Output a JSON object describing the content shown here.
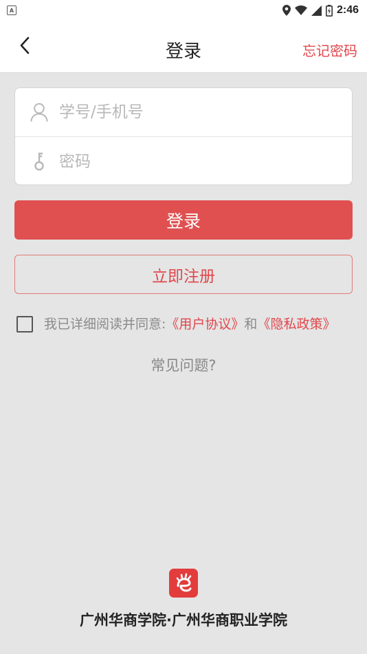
{
  "status_bar": {
    "time": "2:46",
    "notification_letter": "A",
    "icons": [
      "location-icon",
      "wifi-icon",
      "signal-icon",
      "battery-icon"
    ]
  },
  "header": {
    "title": "登录",
    "forgot_password": "忘记密码",
    "back_icon": "chevron-left-icon"
  },
  "form": {
    "username_placeholder": "学号/手机号",
    "username_value": "",
    "password_placeholder": "密码",
    "password_value": "",
    "username_icon": "user-icon",
    "password_icon": "key-icon"
  },
  "buttons": {
    "login": "登录",
    "register": "立即注册"
  },
  "agreement": {
    "checked": false,
    "prefix": "我已详细阅读并同意:",
    "user_agreement": "《用户协议》",
    "conjunction": "和",
    "privacy_policy": "《隐私政策》"
  },
  "faq": "常见问题?",
  "footer": {
    "text": "广州华商学院·广州华商职业学院",
    "logo_icon": "school-logo-icon"
  },
  "colors": {
    "accent": "#e05050",
    "link": "#e0474c",
    "background": "#e5e5e5"
  }
}
